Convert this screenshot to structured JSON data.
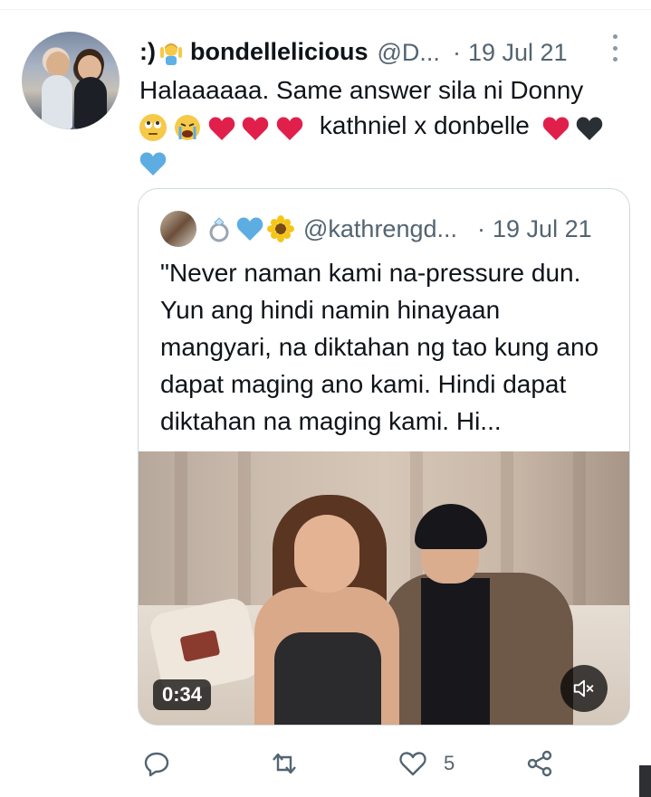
{
  "tweet": {
    "display_name_prefix": ":)",
    "display_name": "bondellelicious",
    "handle": "@D...",
    "separator": "·",
    "date": "19 Jul 21",
    "text_line1": "Halaaaaaa. Same answer sila ni Donny",
    "text_line2_words": "kathniel x donbelle",
    "avatar_label": "profile photo"
  },
  "quote": {
    "handle": "@kathrengd...",
    "separator": "·",
    "date": "19 Jul 21",
    "text": "\"Never naman kami na-pressure dun. Yun ang hindi namin hinayaan mangyari, na diktahan ng tao kung ano dapat maging ano kami. Hindi dapat diktahan na maging kami. Hi...",
    "video_duration": "0:34"
  },
  "actions": {
    "like_count": "5"
  },
  "colors": {
    "text_primary": "#0f1419",
    "text_secondary": "#536471",
    "border": "#cfd9de",
    "heart_red": "#e0204b",
    "heart_black": "#2a2f35",
    "heart_blue": "#5dade2"
  },
  "icons": [
    "more-icon",
    "reply-icon",
    "retweet-icon",
    "like-icon",
    "share-icon",
    "mute-icon"
  ]
}
